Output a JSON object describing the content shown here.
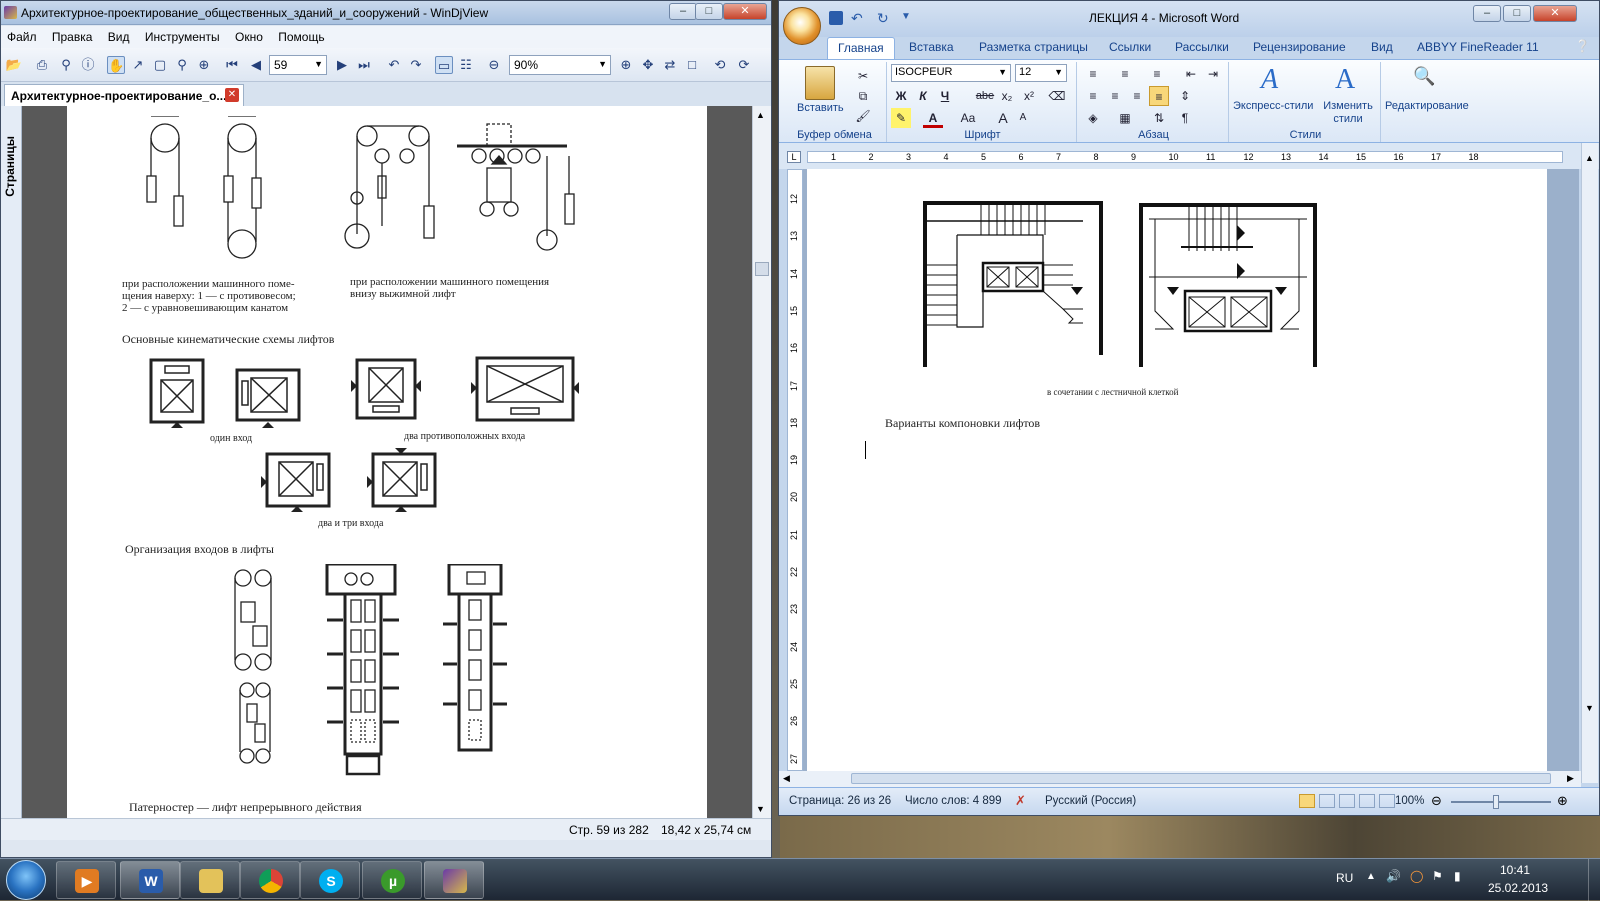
{
  "djview": {
    "title": "Архитектурное-проектирование_общественных_зданий_и_сооружений - WinDjView",
    "menu": [
      "Файл",
      "Правка",
      "Вид",
      "Инструменты",
      "Окно",
      "Помощь"
    ],
    "page_input": "59",
    "zoom_input": "90%",
    "tab_label": "Архитектурное-проектирование_о...",
    "side_tab": "Страницы",
    "status_page": "Стр. 59 из 282",
    "status_size": "18,42 x 25,74 см",
    "doc": {
      "caption_top_left_1": "при расположении машинного поме-",
      "caption_top_left_2": "щения наверху: 1 — с противовесом;",
      "caption_top_left_3": "2 — с уравновешивающим канатом",
      "caption_top_right_1": "при расположении машинного помещения",
      "caption_top_right_2": "внизу выжимной лифт",
      "heading_1": "Основные кинематические схемы лифтов",
      "label_one_entrance": "один вход",
      "label_two_opposite": "два противоположных входа",
      "label_two_three": "два и три входа",
      "heading_2": "Организация входов в лифты",
      "heading_3": "Патерностер — лифт непрерывного действия"
    }
  },
  "word": {
    "title": "ЛЕКЦИЯ 4 - Microsoft Word",
    "tabs": [
      "Главная",
      "Вставка",
      "Разметка страницы",
      "Ссылки",
      "Рассылки",
      "Рецензирование",
      "Вид",
      "ABBYY FineReader 11"
    ],
    "ribbon": {
      "paste": "Вставить",
      "clipboard": "Буфер обмена",
      "font_name": "ISOCPEUR",
      "font_size": "12",
      "font_group": "Шрифт",
      "paragraph_group": "Абзац",
      "express_styles": "Экспресс-стили",
      "change_styles": "Изменить стили",
      "styles_group": "Стили",
      "editing": "Редактирование",
      "bold": "Ж",
      "italic": "К",
      "underline": "Ч",
      "strike": "abe",
      "sub": "x₂",
      "sup": "x²",
      "case": "Aa",
      "grow": "A",
      "shrink": "A"
    },
    "doc": {
      "figure_caption": "в сочетании с лестничной клеткой",
      "heading": "Варианты компоновки лифтов"
    },
    "ruler_h": [
      "1",
      "2",
      "3",
      "4",
      "5",
      "6",
      "7",
      "8",
      "9",
      "10",
      "11",
      "12",
      "13",
      "14",
      "15",
      "16",
      "17",
      "18"
    ],
    "ruler_v": [
      "12",
      "13",
      "14",
      "15",
      "16",
      "17",
      "18",
      "19",
      "20",
      "21",
      "22",
      "23",
      "24",
      "25",
      "26",
      "27"
    ],
    "status": {
      "page": "Страница: 26 из 26",
      "words": "Число слов: 4 899",
      "language": "Русский (Россия)",
      "zoom": "100%"
    }
  },
  "taskbar": {
    "lang": "RU",
    "time": "10:41",
    "date": "25.02.2013"
  },
  "colors": {
    "word_ribbon_text": "#15428b",
    "close_button": "#c7432a",
    "taskbar": "#1f2d3f"
  }
}
